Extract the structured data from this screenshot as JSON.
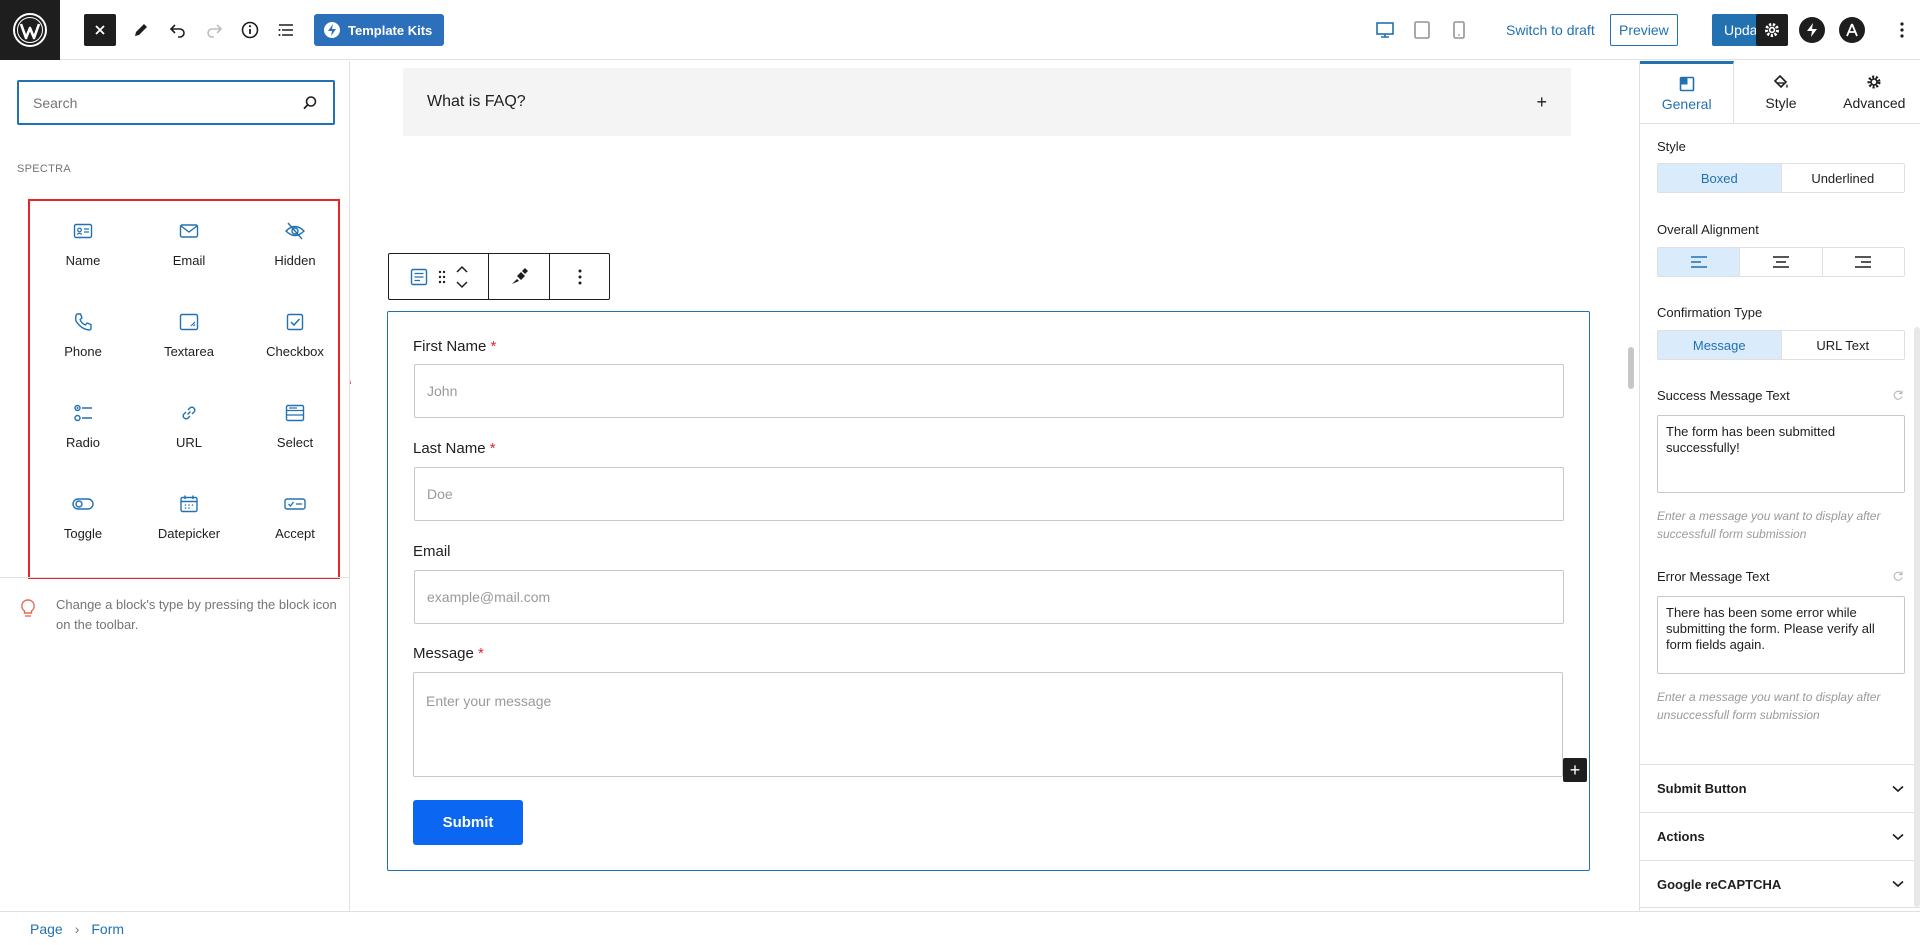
{
  "topbar": {
    "template_kits_label": "Template Kits",
    "switch_to_draft_label": "Switch to draft",
    "preview_label": "Preview",
    "update_label": "Update",
    "icons": [
      "wordpress-logo",
      "close-icon",
      "pencil-icon",
      "undo-icon",
      "redo-icon",
      "info-icon",
      "list-view-icon",
      "desktop-icon",
      "tablet-icon",
      "mobile-icon",
      "settings-icon",
      "spectra-icon",
      "astra-icon",
      "more-vertical-icon"
    ]
  },
  "inserter": {
    "search_placeholder": "Search",
    "category_label": "SPECTRA",
    "blocks": [
      {
        "label": "Name",
        "icon": "name-icon"
      },
      {
        "label": "Email",
        "icon": "email-icon"
      },
      {
        "label": "Hidden",
        "icon": "hidden-icon"
      },
      {
        "label": "Phone",
        "icon": "phone-icon"
      },
      {
        "label": "Textarea",
        "icon": "textarea-icon"
      },
      {
        "label": "Checkbox",
        "icon": "checkbox-icon"
      },
      {
        "label": "Radio",
        "icon": "radio-icon"
      },
      {
        "label": "URL",
        "icon": "url-icon"
      },
      {
        "label": "Select",
        "icon": "select-icon"
      },
      {
        "label": "Toggle",
        "icon": "toggle-icon"
      },
      {
        "label": "Datepicker",
        "icon": "datepicker-icon"
      },
      {
        "label": "Accept",
        "icon": "accept-icon"
      }
    ],
    "tip_text": "Change a block's type by pressing the block icon on the toolbar."
  },
  "canvas": {
    "faq_title": "What is FAQ?",
    "faq_toggle": "+",
    "form": {
      "first_name_label": "First Name",
      "first_name_placeholder": "John",
      "last_name_label": "Last Name",
      "last_name_placeholder": "Doe",
      "email_label": "Email",
      "email_placeholder": "example@mail.com",
      "message_label": "Message",
      "message_placeholder": "Enter your message",
      "required_marker": "*",
      "add_block_symbol": "+",
      "submit_label": "Submit"
    }
  },
  "settings": {
    "tabs": [
      {
        "label": "General",
        "active": true
      },
      {
        "label": "Style",
        "active": false
      },
      {
        "label": "Advanced",
        "active": false
      }
    ],
    "style_label": "Style",
    "style_options": [
      "Boxed",
      "Underlined"
    ],
    "style_selected": "Boxed",
    "alignment_label": "Overall Alignment",
    "confirmation_label": "Confirmation Type",
    "confirmation_options": [
      "Message",
      "URL Text"
    ],
    "confirmation_selected": "Message",
    "success_label": "Success Message Text",
    "success_value": "The form has been submitted successfully!",
    "success_help": "Enter a message you want to display after successfull form submission",
    "error_label": "Error Message Text",
    "error_value": "There has been some error while submitting the form. Please verify all form fields again.",
    "error_help": "Enter a message you want to display after unsuccessfull form submission",
    "panels": [
      "Submit Button",
      "Actions",
      "Google reCAPTCHA"
    ]
  },
  "breadcrumb": {
    "items": [
      "Page",
      "Form"
    ],
    "separator": "›"
  },
  "colors": {
    "accent": "#2271b1",
    "template_kits": "#2c6fbb",
    "submit": "#0b66f2",
    "highlight_border": "#e5272b",
    "required": "#e5272b",
    "segment_active_bg": "#daebfb"
  }
}
